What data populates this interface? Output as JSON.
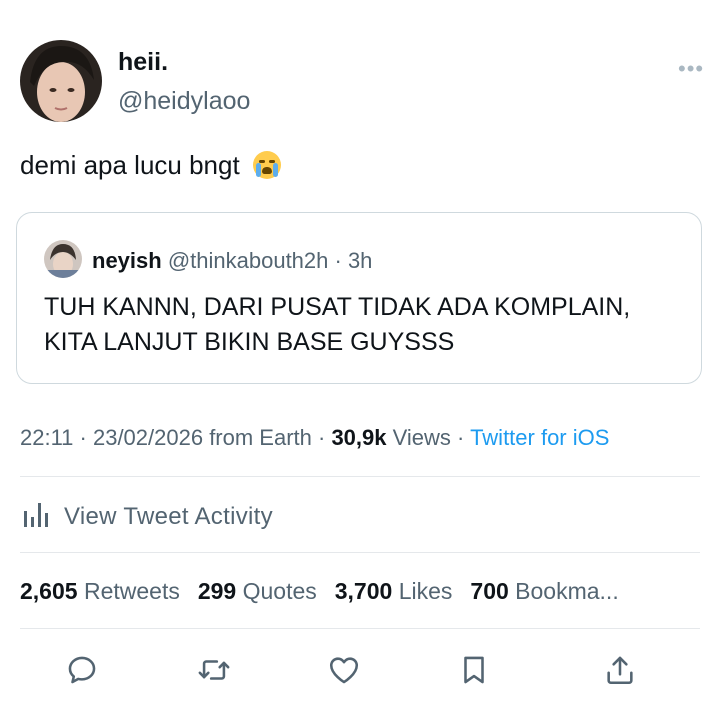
{
  "author": {
    "display_name": "heii.",
    "handle": "@heidylaoo"
  },
  "tweet": {
    "text": "demi apa lucu bngt",
    "emoji": "loudly-crying-face"
  },
  "quoted_tweet": {
    "display_name": "neyish",
    "meta": "@thinkabouth2h · 3h",
    "text": "TUH KANNN, DARI PUSAT TIDAK ADA KOMPLAIN, KITA LANJUT BIKIN BASE GUYSSS"
  },
  "meta": {
    "time_date_place": "22:11 · 23/02/2026 from Earth · ",
    "views_count": "30,9k",
    "views_label": " Views · ",
    "client": "Twitter for iOS"
  },
  "activity": {
    "label": "View Tweet Activity"
  },
  "stats": {
    "retweets_count": "2,605",
    "retweets_label": "Retweets",
    "quotes_count": "299",
    "quotes_label": "Quotes",
    "likes_count": "3,700",
    "likes_label": "Likes",
    "bookmarks_count": "700",
    "bookmarks_label": "Bookma..."
  },
  "colors": {
    "link": "#1d9bf0",
    "secondary_text": "#536471",
    "border": "#cfd9de"
  },
  "icons": [
    "more-icon",
    "analytics-icon",
    "reply-icon",
    "retweet-icon",
    "like-icon",
    "bookmark-icon",
    "share-icon"
  ]
}
